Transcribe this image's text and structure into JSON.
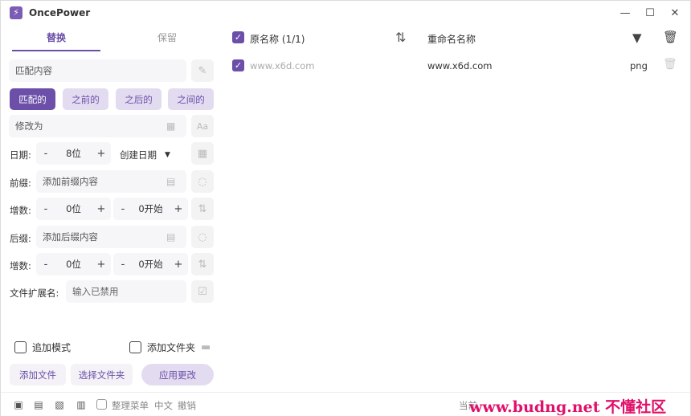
{
  "app": {
    "title": "OncePower"
  },
  "window_controls": {
    "minimize": "—",
    "maximize": "☐",
    "close": "✕"
  },
  "tabs": {
    "replace": "替换",
    "keep": "保留"
  },
  "match": {
    "placeholder": "匹配内容",
    "chips": [
      "匹配的",
      "之前的",
      "之后的",
      "之间的"
    ],
    "modify_placeholder": "修改为"
  },
  "date_row": {
    "label": "日期:",
    "minus": "-",
    "value": "8位",
    "plus": "+",
    "type": "创建日期"
  },
  "prefix_row": {
    "label": "前缀:",
    "placeholder": "添加前缀内容"
  },
  "increment_row_1": {
    "label": "增数:",
    "digits": "0位",
    "start": "0开始",
    "minus": "-",
    "plus": "+"
  },
  "suffix_row": {
    "label": "后缀:",
    "placeholder": "添加后缀内容"
  },
  "increment_row_2": {
    "label": "增数:",
    "digits": "0位",
    "start": "0开始",
    "minus": "-",
    "plus": "+"
  },
  "extension_row": {
    "label": "文件扩展名:",
    "placeholder": "输入已禁用"
  },
  "options": {
    "append_mode": "追加模式",
    "add_folder": "添加文件夹"
  },
  "buttons": {
    "add_file": "添加文件",
    "select_folder": "选择文件夹",
    "apply": "应用更改"
  },
  "table": {
    "header_original": "原名称 (1/1)",
    "header_renamed": "重命名名称",
    "rows": [
      {
        "original": "www.x6d.com",
        "renamed": "www.x6d.com",
        "ext": "png"
      }
    ]
  },
  "bottom": {
    "organize_menu": "整理菜单",
    "language": "中文",
    "undo": "撤销",
    "current_prefix": "当前"
  },
  "watermark": "www.budng.net 不懂社区",
  "colors": {
    "accent": "#6b4fa8",
    "chip_bg": "#e3dcf1",
    "watermark": "#e0106a"
  }
}
